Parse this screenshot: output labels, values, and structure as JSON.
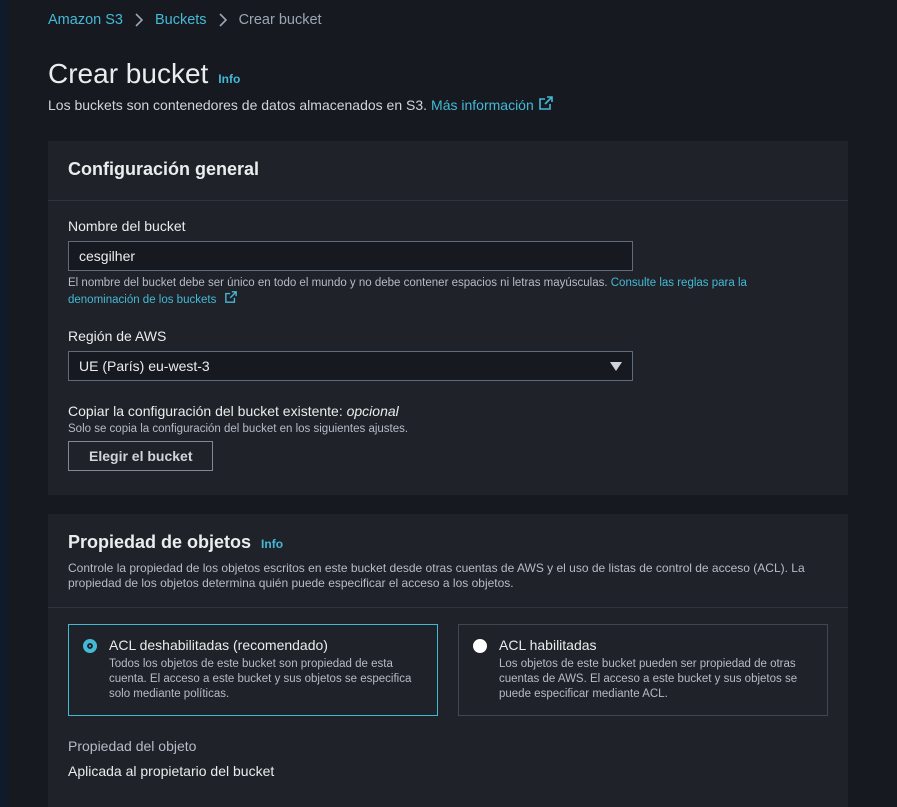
{
  "breadcrumb": {
    "items": [
      "Amazon S3",
      "Buckets"
    ],
    "current": "Crear bucket"
  },
  "header": {
    "title": "Crear bucket",
    "info": "Info",
    "subtitle": "Los buckets son contenedores de datos almacenados en S3.",
    "more_info": "Más información"
  },
  "general": {
    "title": "Configuración general",
    "name_label": "Nombre del bucket",
    "name_value": "cesgilher",
    "name_hint": "El nombre del bucket debe ser único en todo el mundo y no debe contener espacios ni letras mayúsculas.",
    "name_hint_link": "Consulte las reglas para la denominación de los buckets",
    "region_label": "Región de AWS",
    "region_value": "UE (París) eu-west-3",
    "copy_label": "Copiar la configuración del bucket existente:",
    "copy_optional": "opcional",
    "copy_hint": "Solo se copia la configuración del bucket en los siguientes ajustes.",
    "choose_button": "Elegir el bucket"
  },
  "ownership": {
    "title": "Propiedad de objetos",
    "info": "Info",
    "description": "Controle la propiedad de los objetos escritos en este bucket desde otras cuentas de AWS y el uso de listas de control de acceso (ACL). La propiedad de los objetos determina quién puede especificar el acceso a los objetos.",
    "options": [
      {
        "title": "ACL deshabilitadas (recomendado)",
        "desc": "Todos los objetos de este bucket son propiedad de esta cuenta. El acceso a este bucket y sus objetos se especifica solo mediante políticas.",
        "selected": true
      },
      {
        "title": "ACL habilitadas",
        "desc": "Los objetos de este bucket pueden ser propiedad de otras cuentas de AWS. El acceso a este bucket y sus objetos se puede especificar mediante ACL.",
        "selected": false
      }
    ],
    "object_ownership_label": "Propiedad del objeto",
    "object_ownership_value": "Aplicada al propietario del bucket"
  },
  "colors": {
    "accent": "#44b9d6",
    "panel": "#1f2228",
    "background": "#16191f"
  }
}
